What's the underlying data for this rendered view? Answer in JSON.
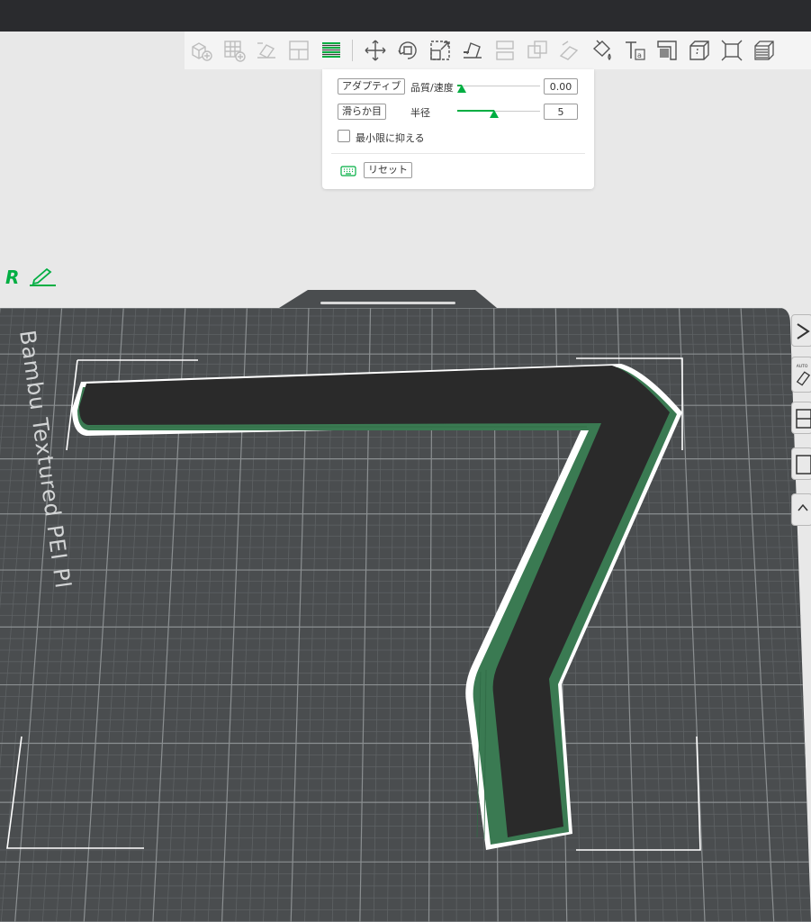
{
  "toolbar": {
    "icons": [
      "add-object-icon",
      "arrange-grid-icon",
      "auto-orient-icon",
      "split-layout-icon",
      "layers-icon",
      "move-icon",
      "rotate-icon",
      "scale-icon",
      "lay-on-face-icon",
      "cut-icon",
      "boolean-icon",
      "support-paint-icon",
      "color-paint-icon",
      "text-icon",
      "measure-icon",
      "assembly-icon",
      "fit-icon",
      "variable-layer-height-icon"
    ],
    "active": "layers-icon"
  },
  "panel": {
    "adaptive_label": "アダプティブ",
    "quality_label": "品質/速度",
    "quality_value": "0.00",
    "quality_slider_fraction": 0.05,
    "smooth_label": "滑らか目",
    "radius_label": "半径",
    "radius_value": "5",
    "radius_slider_fraction": 0.45,
    "keep_min_label": "最小限に抑える",
    "keep_min_checked": false,
    "reset_label": "リセット"
  },
  "scene": {
    "object_label": "R",
    "plate_name": "Bambu Textured PEI Pl",
    "accent": "#00ae42",
    "plate_color": "#4a4d4f",
    "model_top_color": "#2a2a2a",
    "model_side_color": "#3a7a52"
  }
}
